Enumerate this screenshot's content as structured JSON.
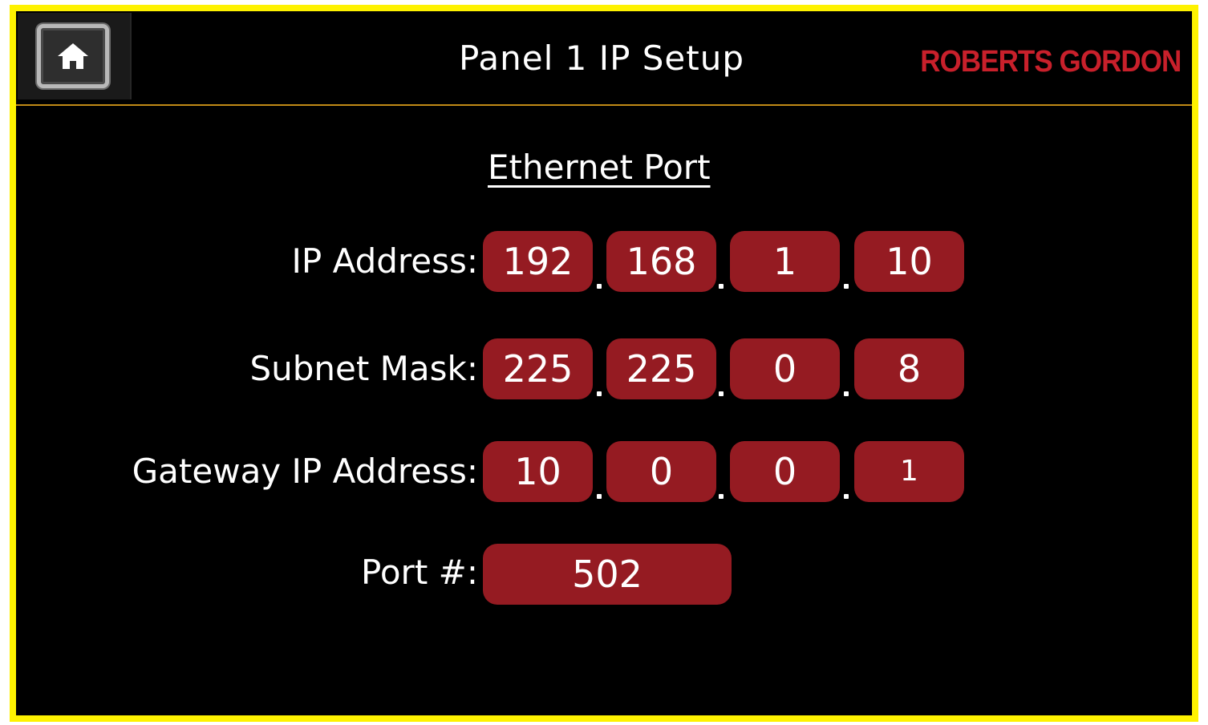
{
  "header": {
    "title": "Panel 1 IP Setup",
    "brand": "ROBERTS GORDON",
    "home_icon": "home-icon"
  },
  "section": {
    "title": "Ethernet Port"
  },
  "rows": {
    "ip": {
      "label": "IP Address:",
      "octets": [
        "192",
        "168",
        "1",
        "10"
      ]
    },
    "subnet": {
      "label": "Subnet Mask:",
      "octets": [
        "225",
        "225",
        "0",
        "8"
      ]
    },
    "gateway": {
      "label": "Gateway IP Address:",
      "octets": [
        "10",
        "0",
        "0",
        "1"
      ]
    },
    "port": {
      "label": "Port #:",
      "value": "502"
    }
  },
  "colors": {
    "frame_border": "#fef200",
    "background": "#000000",
    "field": "#951b22",
    "brand": "#c8202b",
    "header_line": "#c08a16"
  }
}
